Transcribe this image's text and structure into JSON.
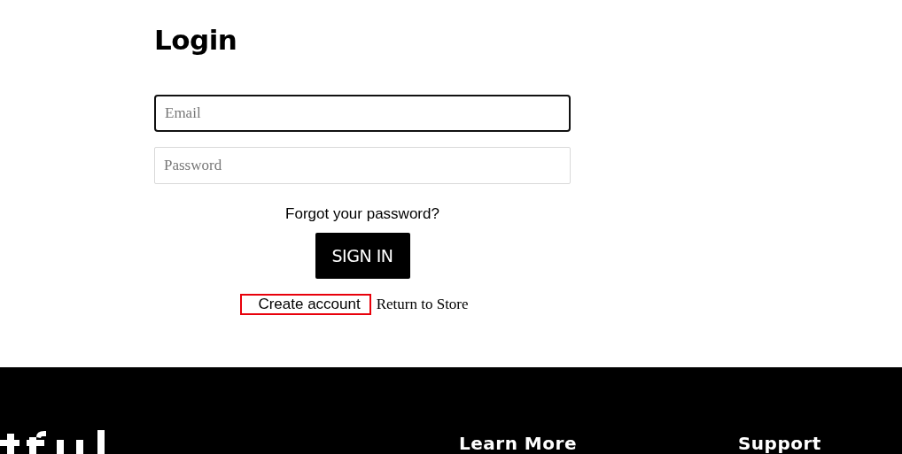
{
  "title": "Login",
  "fields": [
    {
      "placeholder": "Email",
      "focused": true
    },
    {
      "placeholder": "Password",
      "focused": false
    }
  ],
  "forgot_link": "Forgot your password?",
  "submit_button": "SIGN IN",
  "links": [
    {
      "label": "Create account",
      "highlighted": true,
      "kind": "sans"
    },
    {
      "label": "Return to Store",
      "highlighted": false,
      "kind": "serif"
    }
  ],
  "footer": {
    "headings": [
      "Learn More",
      "Support"
    ]
  }
}
